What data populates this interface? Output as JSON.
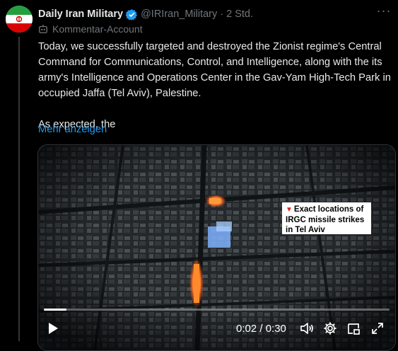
{
  "author": {
    "name": "Daily Iran Military",
    "handle": "@IRIran_Military",
    "separator": "·",
    "time": "2 Std.",
    "verified": true,
    "account_label": "Kommentar-Account"
  },
  "tweet": {
    "paragraph1": "Today, we successfully targeted and destroyed the Zionist regime's Central Command for Communications, Control, and Intelligence, along with the its army's Intelligence and Operations Center in the Gav-Yam High-Tech Park in occupied Jaffa (Tel Aviv), Palestine.",
    "paragraph2": "As expected, the",
    "show_more": "Mehr anzeigen"
  },
  "video": {
    "callout_text": "Exact locations of IRGC missile strikes in Tel Aviv",
    "current_time": "0:02",
    "total_time": "0:30",
    "timecode": "0:02 / 0:30",
    "progress": 0.066
  },
  "icons": {
    "more": "more-dots-icon",
    "verified": "verified-badge-icon",
    "bot": "bot-icon",
    "play": "play-icon",
    "volume": "volume-icon",
    "settings": "gear-icon",
    "pip": "picture-in-picture-icon",
    "fullscreen": "fullscreen-icon"
  },
  "colors": {
    "background": "#000000",
    "text": "#e7e9ea",
    "muted": "#71767b",
    "link": "#1d9bf0",
    "verified": "#1d9bf0",
    "callout_marker": "#e0201b"
  }
}
